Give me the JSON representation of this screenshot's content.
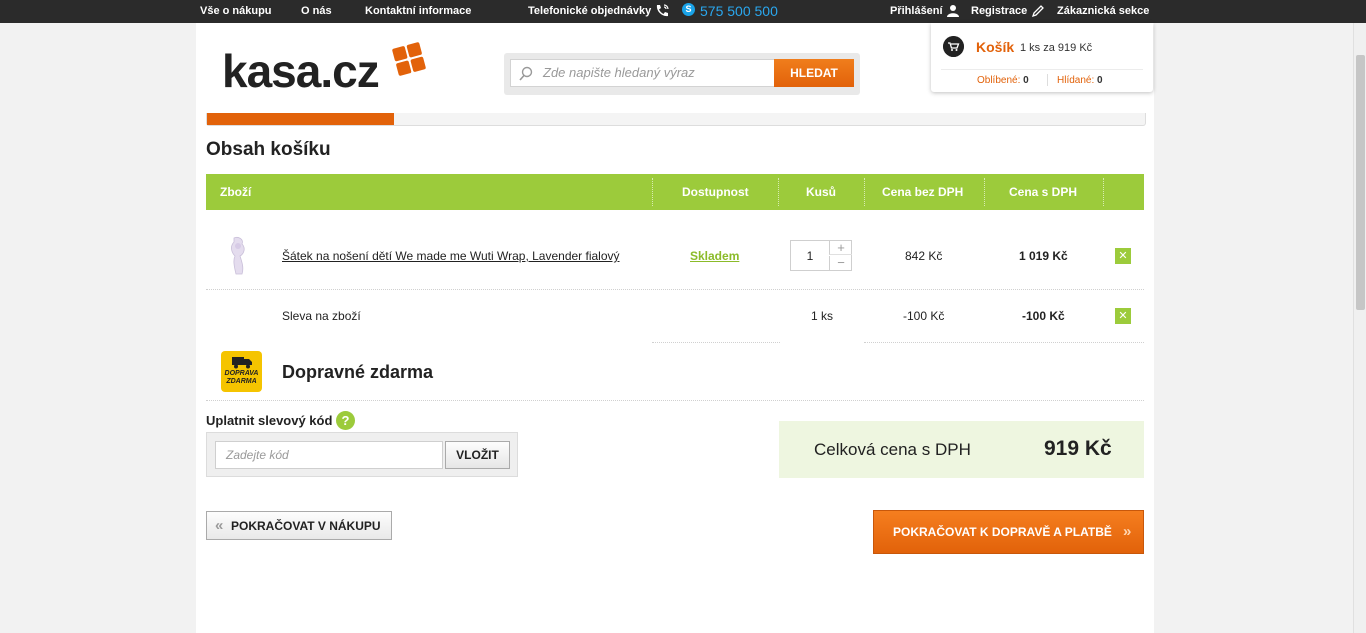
{
  "topbar": {
    "links": [
      "Vše o nákupu",
      "O nás",
      "Kontaktní informace"
    ],
    "phone_label": "Telefonické objednávky",
    "phone_number": "575 500 500",
    "login": "Přihlášení",
    "register": "Registrace",
    "customer": "Zákaznická sekce"
  },
  "logo": {
    "text": "kasa.cz"
  },
  "search": {
    "placeholder": "Zde napište hledaný výraz",
    "button": "HLEDAT"
  },
  "cart": {
    "title": "Košík",
    "info": "1 ks za 919 Kč",
    "favorites_label": "Oblíbené:",
    "favorites_count": "0",
    "watched_label": "Hlídané:",
    "watched_count": "0"
  },
  "page_title": "Obsah košíku",
  "table": {
    "headers": {
      "item": "Zboží",
      "availability": "Dostupnost",
      "qty": "Kusů",
      "price_net": "Cena bez DPH",
      "price_gross": "Cena s DPH"
    },
    "product": {
      "name": "Šátek na nošení dětí We made me Wuti Wrap, Lavender fialový",
      "availability": "Skladem",
      "qty": "1",
      "price_net": "842 Kč",
      "price_gross": "1 019 Kč"
    },
    "discount": {
      "label": "Sleva na zboží",
      "qty": "1 ks",
      "price_net": "-100 Kč",
      "price_gross": "-100 Kč"
    }
  },
  "shipping": {
    "icon_text": "DOPRAVA ZDARMA",
    "title": "Dopravné zdarma"
  },
  "coupon": {
    "label": "Uplatnit slevový kód",
    "placeholder": "Zadejte kód",
    "button": "VLOŽIT"
  },
  "total": {
    "label": "Celková cena s DPH",
    "value": "919 Kč"
  },
  "buttons": {
    "back": "POKRAČOVAT V NÁKUPU",
    "next": "POKRAČOVAT K DOPRAVĚ A PLATBĚ"
  },
  "colors": {
    "accent": "#e2620a",
    "green": "#9ccb3b",
    "total_bg": "#eef6e0"
  }
}
